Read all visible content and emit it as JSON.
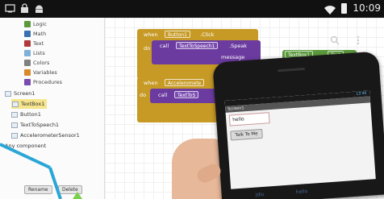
{
  "status_bar": {
    "time": "10:09",
    "left_icons": [
      "screen-icon",
      "lock-icon",
      "android-icon"
    ]
  },
  "palette": {
    "built_in": [
      {
        "label": "Logic",
        "color": "#5b9a3c"
      },
      {
        "label": "Math",
        "color": "#3a6fb0"
      },
      {
        "label": "Text",
        "color": "#b03a3a"
      },
      {
        "label": "Lists",
        "color": "#7fb0d8"
      },
      {
        "label": "Colors",
        "color": "#808080"
      },
      {
        "label": "Variables",
        "color": "#d98a2b"
      },
      {
        "label": "Procedures",
        "color": "#7a4bb0"
      }
    ],
    "tree": [
      {
        "label": "Screen1"
      },
      {
        "label": "TextBox1",
        "selected": true
      },
      {
        "label": "Button1"
      },
      {
        "label": "TextToSpeech1"
      },
      {
        "label": "AccelerometerSensor1"
      }
    ],
    "any_component": "Any component",
    "rename_button": "Rename",
    "delete_button": "Delete"
  },
  "blocks": {
    "event1": {
      "when": "when",
      "component": "Button1",
      "event": ".Click",
      "do": "do"
    },
    "call1": {
      "call": "call",
      "component": "TextToSpeech1",
      "method": ".Speak",
      "arg_label": "message",
      "arg_component": "TextBox1",
      "arg_prop": "Text"
    },
    "event2": {
      "when": "when",
      "component": "Acceleromete"
    },
    "call2": {
      "do": "do",
      "call": "call",
      "component": "TextToS"
    }
  },
  "phone": {
    "time": "12:46",
    "screen_title": "Screen1",
    "textbox_value": "hello",
    "button_label": "Talk To Me",
    "bottom_text": [
      "jdiu",
      "hello"
    ]
  },
  "colors": {
    "event_block": "#c79a26",
    "call_block": "#6b3ba0",
    "arrow": "#2aa6d6"
  }
}
